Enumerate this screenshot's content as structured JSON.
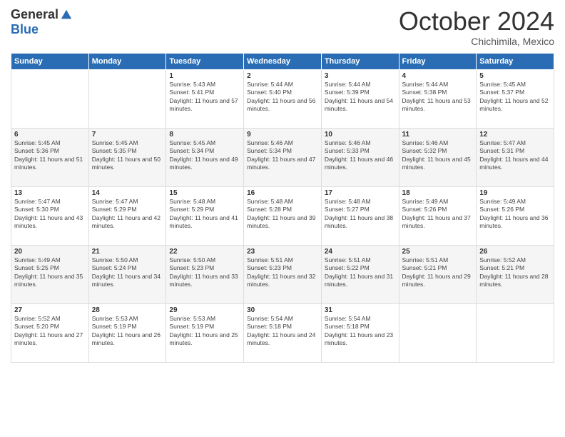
{
  "logo": {
    "general": "General",
    "blue": "Blue"
  },
  "header": {
    "month": "October 2024",
    "location": "Chichimila, Mexico"
  },
  "weekdays": [
    "Sunday",
    "Monday",
    "Tuesday",
    "Wednesday",
    "Thursday",
    "Friday",
    "Saturday"
  ],
  "weeks": [
    [
      null,
      null,
      {
        "day": 1,
        "sunrise": "5:43 AM",
        "sunset": "5:41 PM",
        "daylight": "11 hours and 57 minutes."
      },
      {
        "day": 2,
        "sunrise": "5:44 AM",
        "sunset": "5:40 PM",
        "daylight": "11 hours and 56 minutes."
      },
      {
        "day": 3,
        "sunrise": "5:44 AM",
        "sunset": "5:39 PM",
        "daylight": "11 hours and 54 minutes."
      },
      {
        "day": 4,
        "sunrise": "5:44 AM",
        "sunset": "5:38 PM",
        "daylight": "11 hours and 53 minutes."
      },
      {
        "day": 5,
        "sunrise": "5:45 AM",
        "sunset": "5:37 PM",
        "daylight": "11 hours and 52 minutes."
      }
    ],
    [
      {
        "day": 6,
        "sunrise": "5:45 AM",
        "sunset": "5:36 PM",
        "daylight": "11 hours and 51 minutes."
      },
      {
        "day": 7,
        "sunrise": "5:45 AM",
        "sunset": "5:35 PM",
        "daylight": "11 hours and 50 minutes."
      },
      {
        "day": 8,
        "sunrise": "5:45 AM",
        "sunset": "5:34 PM",
        "daylight": "11 hours and 49 minutes."
      },
      {
        "day": 9,
        "sunrise": "5:46 AM",
        "sunset": "5:34 PM",
        "daylight": "11 hours and 47 minutes."
      },
      {
        "day": 10,
        "sunrise": "5:46 AM",
        "sunset": "5:33 PM",
        "daylight": "11 hours and 46 minutes."
      },
      {
        "day": 11,
        "sunrise": "5:46 AM",
        "sunset": "5:32 PM",
        "daylight": "11 hours and 45 minutes."
      },
      {
        "day": 12,
        "sunrise": "5:47 AM",
        "sunset": "5:31 PM",
        "daylight": "11 hours and 44 minutes."
      }
    ],
    [
      {
        "day": 13,
        "sunrise": "5:47 AM",
        "sunset": "5:30 PM",
        "daylight": "11 hours and 43 minutes."
      },
      {
        "day": 14,
        "sunrise": "5:47 AM",
        "sunset": "5:29 PM",
        "daylight": "11 hours and 42 minutes."
      },
      {
        "day": 15,
        "sunrise": "5:48 AM",
        "sunset": "5:29 PM",
        "daylight": "11 hours and 41 minutes."
      },
      {
        "day": 16,
        "sunrise": "5:48 AM",
        "sunset": "5:28 PM",
        "daylight": "11 hours and 39 minutes."
      },
      {
        "day": 17,
        "sunrise": "5:48 AM",
        "sunset": "5:27 PM",
        "daylight": "11 hours and 38 minutes."
      },
      {
        "day": 18,
        "sunrise": "5:49 AM",
        "sunset": "5:26 PM",
        "daylight": "11 hours and 37 minutes."
      },
      {
        "day": 19,
        "sunrise": "5:49 AM",
        "sunset": "5:26 PM",
        "daylight": "11 hours and 36 minutes."
      }
    ],
    [
      {
        "day": 20,
        "sunrise": "5:49 AM",
        "sunset": "5:25 PM",
        "daylight": "11 hours and 35 minutes."
      },
      {
        "day": 21,
        "sunrise": "5:50 AM",
        "sunset": "5:24 PM",
        "daylight": "11 hours and 34 minutes."
      },
      {
        "day": 22,
        "sunrise": "5:50 AM",
        "sunset": "5:23 PM",
        "daylight": "11 hours and 33 minutes."
      },
      {
        "day": 23,
        "sunrise": "5:51 AM",
        "sunset": "5:23 PM",
        "daylight": "11 hours and 32 minutes."
      },
      {
        "day": 24,
        "sunrise": "5:51 AM",
        "sunset": "5:22 PM",
        "daylight": "11 hours and 31 minutes."
      },
      {
        "day": 25,
        "sunrise": "5:51 AM",
        "sunset": "5:21 PM",
        "daylight": "11 hours and 29 minutes."
      },
      {
        "day": 26,
        "sunrise": "5:52 AM",
        "sunset": "5:21 PM",
        "daylight": "11 hours and 28 minutes."
      }
    ],
    [
      {
        "day": 27,
        "sunrise": "5:52 AM",
        "sunset": "5:20 PM",
        "daylight": "11 hours and 27 minutes."
      },
      {
        "day": 28,
        "sunrise": "5:53 AM",
        "sunset": "5:19 PM",
        "daylight": "11 hours and 26 minutes."
      },
      {
        "day": 29,
        "sunrise": "5:53 AM",
        "sunset": "5:19 PM",
        "daylight": "11 hours and 25 minutes."
      },
      {
        "day": 30,
        "sunrise": "5:54 AM",
        "sunset": "5:18 PM",
        "daylight": "11 hours and 24 minutes."
      },
      {
        "day": 31,
        "sunrise": "5:54 AM",
        "sunset": "5:18 PM",
        "daylight": "11 hours and 23 minutes."
      },
      null,
      null
    ]
  ]
}
